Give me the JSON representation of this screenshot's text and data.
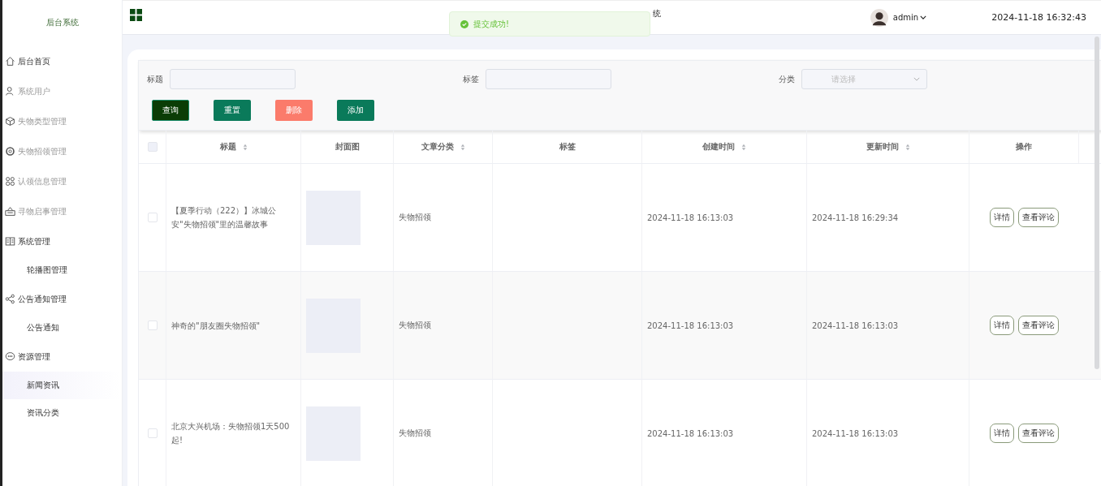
{
  "sidebar": {
    "title": "后台系统",
    "items": [
      {
        "label": "后台首页",
        "dimmed": false,
        "selected": false
      },
      {
        "label": "系统用户",
        "dimmed": true,
        "selected": false
      },
      {
        "label": "失物类型管理",
        "dimmed": true,
        "selected": false
      },
      {
        "label": "失物招领管理",
        "dimmed": true,
        "selected": false
      },
      {
        "label": "认领信息管理",
        "dimmed": true,
        "selected": false
      },
      {
        "label": "寻物启事管理",
        "dimmed": true,
        "selected": false
      },
      {
        "label": "系统管理",
        "dimmed": false,
        "selected": false,
        "children": [
          {
            "label": "轮播图管理",
            "selected": false
          }
        ]
      },
      {
        "label": "公告通知管理",
        "dimmed": false,
        "selected": false,
        "children": [
          {
            "label": "公告通知",
            "selected": false
          }
        ]
      },
      {
        "label": "资源管理",
        "dimmed": false,
        "selected": false,
        "children": [
          {
            "label": "新闻资讯",
            "selected": true
          },
          {
            "label": "资讯分类",
            "selected": false
          }
        ]
      }
    ]
  },
  "header": {
    "title_visible": "统",
    "user": "admin",
    "datetime": "2024-11-18 16:32:43"
  },
  "toast": {
    "message": "提交成功!"
  },
  "filters": [
    {
      "label": "标题",
      "kind": "input"
    },
    {
      "label": "标签",
      "kind": "input"
    },
    {
      "label": "分类",
      "kind": "select",
      "placeholder": "请选择"
    }
  ],
  "buttons": [
    {
      "label": "查询",
      "kind": "query"
    },
    {
      "label": "重置",
      "kind": "reset"
    },
    {
      "label": "删除",
      "kind": "delete"
    },
    {
      "label": "添加",
      "kind": "add"
    }
  ],
  "table": {
    "all_checked": false,
    "columns": [
      {
        "label": "标题",
        "sortable": true
      },
      {
        "label": "封面图",
        "sortable": false
      },
      {
        "label": "文章分类",
        "sortable": true
      },
      {
        "label": "标签",
        "sortable": false
      },
      {
        "label": "创建时间",
        "sortable": true
      },
      {
        "label": "更新时间",
        "sortable": true
      },
      {
        "label": "操作",
        "sortable": false
      }
    ],
    "rows": [
      {
        "checked": false,
        "title": "【夏季行动（222）】冰城公安\"失物招领\"里的温馨故事",
        "category": "失物招领",
        "created": "2024-11-18 16:13:03",
        "updated": "2024-11-18 16:29:34",
        "actions": [
          "详情",
          "查看评论"
        ]
      },
      {
        "checked": false,
        "title": "神奇的\"朋友圈失物招领\"",
        "category": "失物招领",
        "created": "2024-11-18 16:13:03",
        "updated": "2024-11-18 16:13:03",
        "actions": [
          "详情",
          "查看评论"
        ]
      },
      {
        "checked": false,
        "title": "北京大兴机场：失物招领1天500起!",
        "category": "失物招领",
        "created": "2024-11-18 16:13:03",
        "updated": "2024-11-18 16:13:03",
        "actions": [
          "详情",
          "查看评论"
        ]
      }
    ]
  }
}
